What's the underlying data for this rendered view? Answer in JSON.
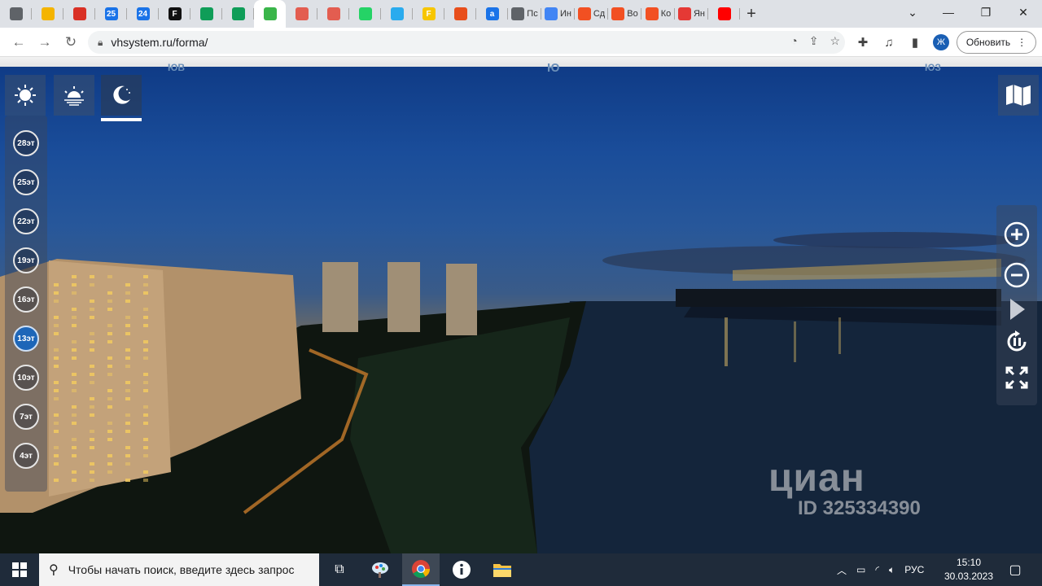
{
  "browser": {
    "tabs": [
      {
        "icon": "circle-site-icon",
        "title": "",
        "color": "#5f6368"
      },
      {
        "icon": "mail-icon",
        "title": "",
        "color": "#f4b400"
      },
      {
        "icon": "gmail-icon",
        "title": "",
        "color": "#d93025"
      },
      {
        "icon": "calendar-icon",
        "title": "",
        "color": "#1a73e8",
        "glyph": "25"
      },
      {
        "icon": "news-24-icon",
        "title": "",
        "color": "#1a73e8",
        "glyph": "24"
      },
      {
        "icon": "f-icon",
        "title": "",
        "color": "#111111",
        "glyph": "F"
      },
      {
        "icon": "green-plus-icon",
        "title": "",
        "color": "#0f9d58"
      },
      {
        "icon": "green-plus-icon",
        "title": "",
        "color": "#0f9d58"
      },
      {
        "icon": "eye-icon",
        "title": "",
        "color": "#3ab54a",
        "active": true
      },
      {
        "icon": "snowflake-icon",
        "title": "",
        "color": "#e35d50"
      },
      {
        "icon": "snowflake-icon",
        "title": "",
        "color": "#e35d50"
      },
      {
        "icon": "whatsapp-icon",
        "title": "",
        "color": "#25d366"
      },
      {
        "icon": "telegram-icon",
        "title": "",
        "color": "#2aabee"
      },
      {
        "icon": "f-yellow-icon",
        "title": "",
        "color": "#f7c600",
        "glyph": "F"
      },
      {
        "icon": "bird-icon",
        "title": "",
        "color": "#e84e1b"
      },
      {
        "icon": "a-icon",
        "title": "",
        "color": "#1a73e8",
        "glyph": "a"
      },
      {
        "icon": "globe-icon",
        "title": "Пс",
        "color": "#5f6368"
      },
      {
        "icon": "doc-icon",
        "title": "Ин",
        "color": "#4285f4"
      },
      {
        "icon": "ms-icon",
        "title": "Сд",
        "color": "#f25022"
      },
      {
        "icon": "ms-icon",
        "title": "Во",
        "color": "#f25022"
      },
      {
        "icon": "ms-icon",
        "title": "Ко",
        "color": "#f25022"
      },
      {
        "icon": "map-pin-icon",
        "title": "Ян",
        "color": "#e53935"
      },
      {
        "icon": "youtube-icon",
        "title": "",
        "color": "#ff0000"
      }
    ],
    "url": "vhsystem.ru/forma/",
    "update_label": "Обновить",
    "avatar_letter": "Ж"
  },
  "panorama": {
    "compass": {
      "left": "ЮВ",
      "center": "Ю",
      "right": "ЮЗ"
    },
    "time_modes": [
      "day",
      "sunset",
      "night"
    ],
    "floors": [
      "28эт",
      "25эт",
      "22эт",
      "19эт",
      "16эт",
      "13эт",
      "10эт",
      "7эт",
      "4эт"
    ],
    "active_floor": "13эт",
    "watermark_brand": "циан",
    "watermark_id": "ID 325334390"
  },
  "taskbar": {
    "search_placeholder": "Чтобы начать поиск, введите здесь запрос",
    "language": "РУС",
    "time": "15:10",
    "date": "30.03.2023"
  },
  "colors": {
    "tab_strip": "#dee1e6",
    "floor_active": "#1d66b8",
    "taskbar": "#1f2b3a"
  }
}
